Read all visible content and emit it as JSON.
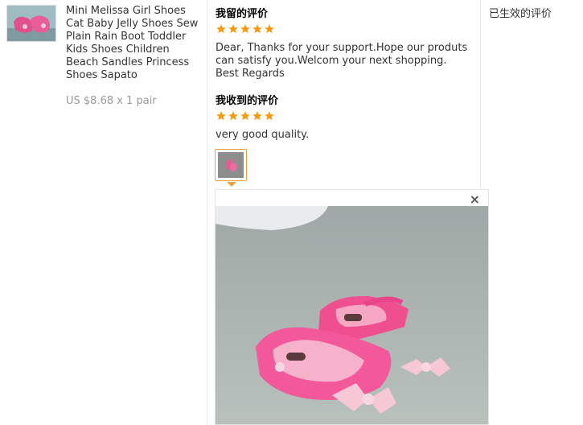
{
  "product": {
    "thumbnail_icon": "product-thumbnail",
    "title": "Mini Melissa Girl Shoes Cat Baby Jelly Shoes Sew Plain Rain Boot Toddler Kids Shoes Children Beach Sandles Princess Shoes Sapato",
    "price": "US $8.68 x 1 pair"
  },
  "my_feedback": {
    "heading": "我留的评价",
    "rating": 5,
    "text": "Dear, Thanks for your support.Hope our produts can satisfy you.Welcom your next shopping. Best Regards"
  },
  "received_feedback": {
    "heading": "我收到的评价",
    "rating": 5,
    "text": "very good quality."
  },
  "status": "已生效的评价",
  "viewer": {
    "close_symbol": "×"
  },
  "colors": {
    "star": "#f59a0f",
    "thumb_border": "#e8a23a",
    "shoe_pink": "#ef5f98",
    "floor": "#a6b2ae"
  }
}
